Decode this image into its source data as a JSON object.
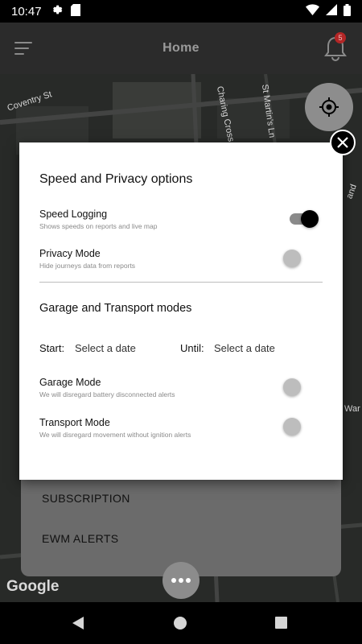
{
  "status_bar": {
    "time": "10:47"
  },
  "header": {
    "title": "Home",
    "notification_count": "5"
  },
  "map": {
    "labels": [
      "Coventry St",
      "Charing Cross Rd",
      "St Martin's Ln",
      "and",
      "War"
    ],
    "google_logo": "Google"
  },
  "bottom_sheet": {
    "items": [
      "SUBSCRIPTION",
      "EWM ALERTS"
    ]
  },
  "modal": {
    "section1_title": "Speed and Privacy options",
    "speed_logging": {
      "label": "Speed Logging",
      "description": "Shows speeds on reports and live map",
      "enabled": true
    },
    "privacy_mode": {
      "label": "Privacy Mode",
      "description": "Hide journeys data from reports",
      "enabled": false
    },
    "section2_title": "Garage and Transport modes",
    "start_label": "Start:",
    "start_value": "Select a date",
    "until_label": "Until:",
    "until_value": "Select a date",
    "garage_mode": {
      "label": "Garage Mode",
      "description": "We will disregard battery disconnected alerts",
      "enabled": false
    },
    "transport_mode": {
      "label": "Transport Mode",
      "description": "We will disregard movement without ignition alerts",
      "enabled": false
    }
  },
  "colors": {
    "header_bg": "#2b2b2b",
    "toggle_on_knob": "#000000",
    "toggle_off_knob": "#bdbdbd"
  }
}
